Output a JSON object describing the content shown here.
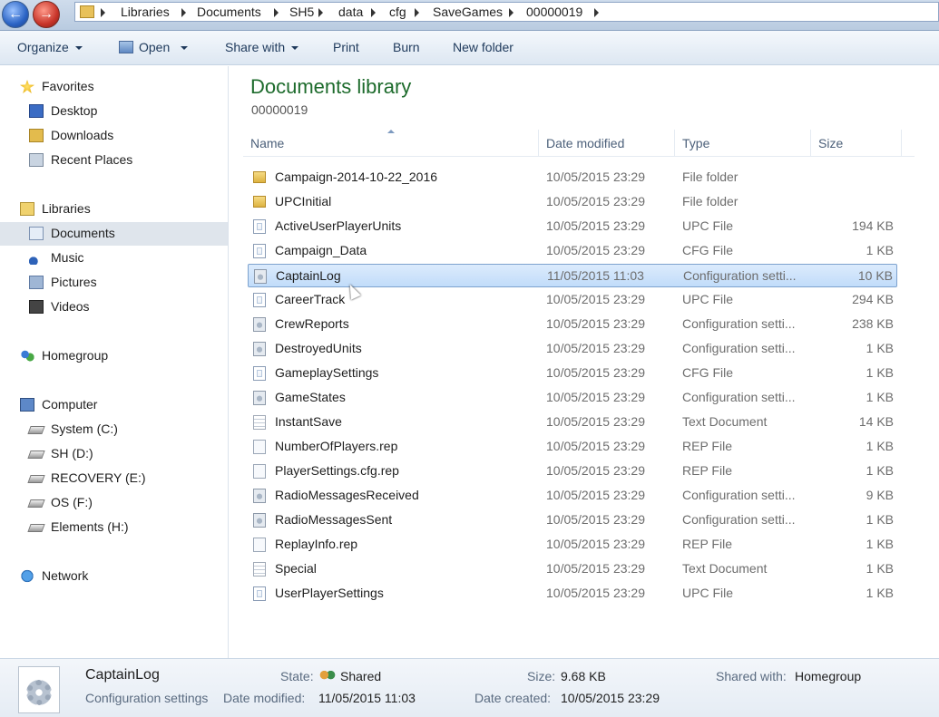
{
  "address": {
    "crumbs": [
      "Libraries",
      "Documents",
      "SH5",
      "data",
      "cfg",
      "SaveGames",
      "00000019"
    ]
  },
  "toolbar": {
    "organize": "Organize",
    "open": "Open",
    "share_with": "Share with",
    "print": "Print",
    "burn": "Burn",
    "new_folder": "New folder"
  },
  "nav": {
    "favorites": "Favorites",
    "desktop": "Desktop",
    "downloads": "Downloads",
    "recent_places": "Recent Places",
    "libraries": "Libraries",
    "documents": "Documents",
    "music": "Music",
    "pictures": "Pictures",
    "videos": "Videos",
    "homegroup": "Homegroup",
    "computer": "Computer",
    "drive_c": "System (C:)",
    "drive_d": "SH  (D:)",
    "drive_e": "RECOVERY (E:)",
    "drive_f": "OS (F:)",
    "drive_h": "Elements (H:)",
    "network": "Network"
  },
  "main": {
    "title": "Documents library",
    "subtitle": "00000019",
    "columns": {
      "name": "Name",
      "date_modified": "Date modified",
      "type": "Type",
      "size": "Size"
    },
    "files": [
      {
        "name": "Campaign-2014-10-22_2016",
        "date": "10/05/2015 23:29",
        "type": "File folder",
        "size": "",
        "icon": "folder-icon"
      },
      {
        "name": "UPCInitial",
        "date": "10/05/2015 23:29",
        "type": "File folder",
        "size": "",
        "icon": "folder-icon"
      },
      {
        "name": "ActiveUserPlayerUnits",
        "date": "10/05/2015 23:29",
        "type": "UPC File",
        "size": "194 KB",
        "icon": "upc-file-icon"
      },
      {
        "name": "Campaign_Data",
        "date": "10/05/2015 23:29",
        "type": "CFG File",
        "size": "1 KB",
        "icon": "upc-file-icon"
      },
      {
        "name": "CaptainLog",
        "date": "11/05/2015 11:03",
        "type": "Configuration setti...",
        "size": "10 KB",
        "icon": "config-file-icon"
      },
      {
        "name": "CareerTrack",
        "date": "10/05/2015 23:29",
        "type": "UPC File",
        "size": "294 KB",
        "icon": "upc-file-icon"
      },
      {
        "name": "CrewReports",
        "date": "10/05/2015 23:29",
        "type": "Configuration setti...",
        "size": "238 KB",
        "icon": "config-file-icon"
      },
      {
        "name": "DestroyedUnits",
        "date": "10/05/2015 23:29",
        "type": "Configuration setti...",
        "size": "1 KB",
        "icon": "config-file-icon"
      },
      {
        "name": "GameplaySettings",
        "date": "10/05/2015 23:29",
        "type": "CFG File",
        "size": "1 KB",
        "icon": "upc-file-icon"
      },
      {
        "name": "GameStates",
        "date": "10/05/2015 23:29",
        "type": "Configuration setti...",
        "size": "1 KB",
        "icon": "config-file-icon"
      },
      {
        "name": "InstantSave",
        "date": "10/05/2015 23:29",
        "type": "Text Document",
        "size": "14 KB",
        "icon": "text-file-icon"
      },
      {
        "name": "NumberOfPlayers.rep",
        "date": "10/05/2015 23:29",
        "type": "REP File",
        "size": "1 KB",
        "icon": "blank-file-icon"
      },
      {
        "name": "PlayerSettings.cfg.rep",
        "date": "10/05/2015 23:29",
        "type": "REP File",
        "size": "1 KB",
        "icon": "blank-file-icon"
      },
      {
        "name": "RadioMessagesReceived",
        "date": "10/05/2015 23:29",
        "type": "Configuration setti...",
        "size": "9 KB",
        "icon": "config-file-icon"
      },
      {
        "name": "RadioMessagesSent",
        "date": "10/05/2015 23:29",
        "type": "Configuration setti...",
        "size": "1 KB",
        "icon": "config-file-icon"
      },
      {
        "name": "ReplayInfo.rep",
        "date": "10/05/2015 23:29",
        "type": "REP File",
        "size": "1 KB",
        "icon": "blank-file-icon"
      },
      {
        "name": "Special",
        "date": "10/05/2015 23:29",
        "type": "Text Document",
        "size": "1 KB",
        "icon": "text-file-icon"
      },
      {
        "name": "UserPlayerSettings",
        "date": "10/05/2015 23:29",
        "type": "UPC File",
        "size": "1 KB",
        "icon": "upc-file-icon"
      }
    ],
    "selected_file": "CaptainLog"
  },
  "details": {
    "name": "CaptainLog",
    "type": "Configuration settings",
    "state_label": "State:",
    "state_value": "Shared",
    "modified_label": "Date modified:",
    "modified_value": "11/05/2015 11:03",
    "size_label": "Size:",
    "size_value": "9.68 KB",
    "created_label": "Date created:",
    "created_value": "10/05/2015 23:29",
    "shared_label": "Shared with:",
    "shared_value": "Homegroup"
  }
}
